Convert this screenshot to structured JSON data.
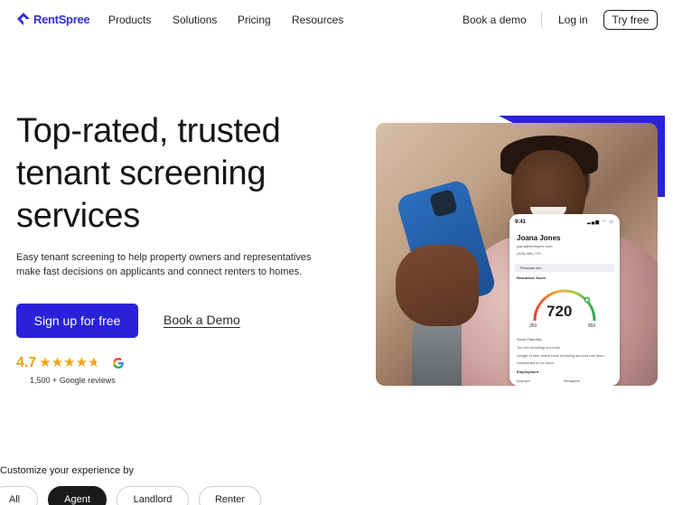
{
  "brand": {
    "name": "RentSpree",
    "color": "#2f2fd6"
  },
  "nav": {
    "links": [
      "Products",
      "Solutions",
      "Pricing",
      "Resources"
    ],
    "book_demo": "Book a demo",
    "login": "Log in",
    "try_free": "Try free"
  },
  "hero": {
    "title": "Top-rated, trusted tenant screening services",
    "subtitle": "Easy tenant screening to help property owners and representatives make fast decisions on applicants and connect renters to homes.",
    "primary_cta": "Sign up for free",
    "secondary_cta": "Book a Demo",
    "accent_color": "#2a22d8"
  },
  "rating": {
    "value": "4.7",
    "stars": 4.7,
    "reviews": "1,500 + Google reviews",
    "provider_icon": "google-icon"
  },
  "phone_card": {
    "time": "9:41",
    "name": "Joana Jones",
    "email": "joana@rentspree.com",
    "phone": "(323)-555-7757",
    "tab": "Personal Info",
    "residence_score_label": "Residence Score",
    "score": "720",
    "score_min": "350",
    "score_max": "850",
    "score_factors_label": "Score Factor(s)",
    "factor_1": "Too few revolving accounts",
    "factor_2": "Length of time oldest bank revolving account has been",
    "factor_3": "established is too short",
    "employment_label": "Employment",
    "employer_col": "Employer",
    "employer_value": "Rentsgreen"
  },
  "customize": {
    "title": "Customize your experience by",
    "options": [
      "All",
      "Agent",
      "Landlord",
      "Renter"
    ],
    "selected": "Agent"
  }
}
